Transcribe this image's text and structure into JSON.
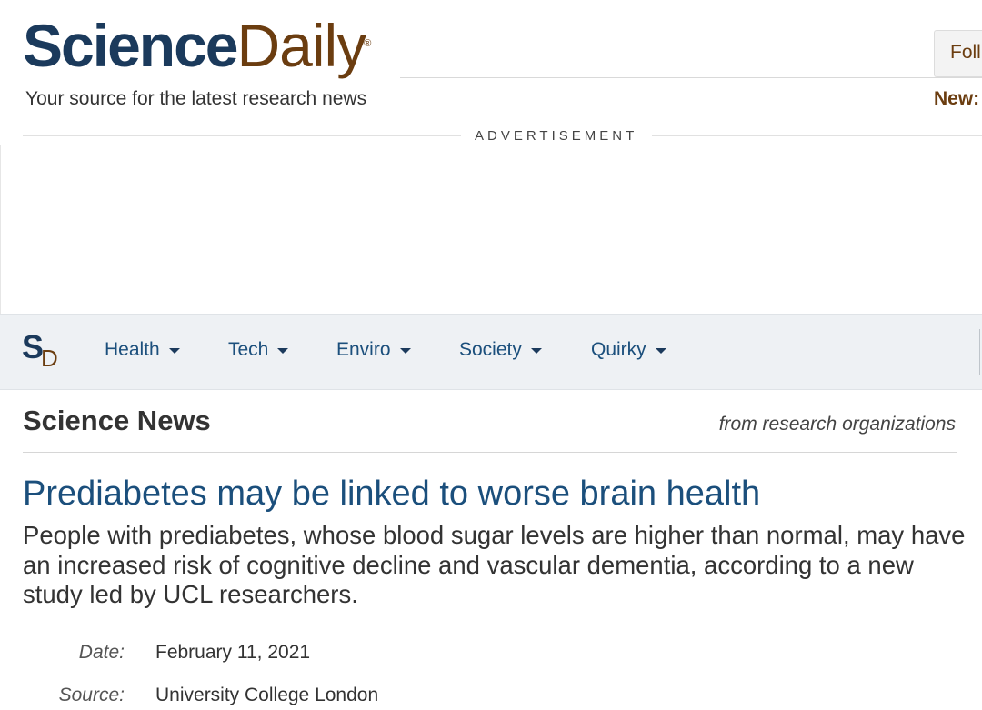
{
  "header": {
    "logo_science": "Science",
    "logo_daily": "Daily",
    "logo_reg": "®",
    "tagline": "Your source for the latest research news",
    "follow_label": "Foll",
    "new_label": "New:"
  },
  "advertisement": {
    "label": "ADVERTISEMENT"
  },
  "nav": {
    "brand_s": "S",
    "brand_d": "D",
    "items": [
      {
        "label": "Health"
      },
      {
        "label": "Tech"
      },
      {
        "label": "Enviro"
      },
      {
        "label": "Society"
      },
      {
        "label": "Quirky"
      }
    ]
  },
  "section": {
    "title": "Science News",
    "subtitle": "from research organizations"
  },
  "article": {
    "headline": "Prediabetes may be linked to worse brain health",
    "summary": "People with prediabetes, whose blood sugar levels are higher than normal, may have an increased risk of cognitive decline and vascular dementia, according to a new study led by UCL researchers.",
    "meta": [
      {
        "label": "Date:",
        "value": "February 11, 2021"
      },
      {
        "label": "Source:",
        "value": "University College London"
      }
    ]
  },
  "colors": {
    "brand_blue": "#1b3a5c",
    "brand_brown": "#6b3d10",
    "link_blue": "#1b4f7c",
    "nav_bg": "#eef1f4"
  }
}
